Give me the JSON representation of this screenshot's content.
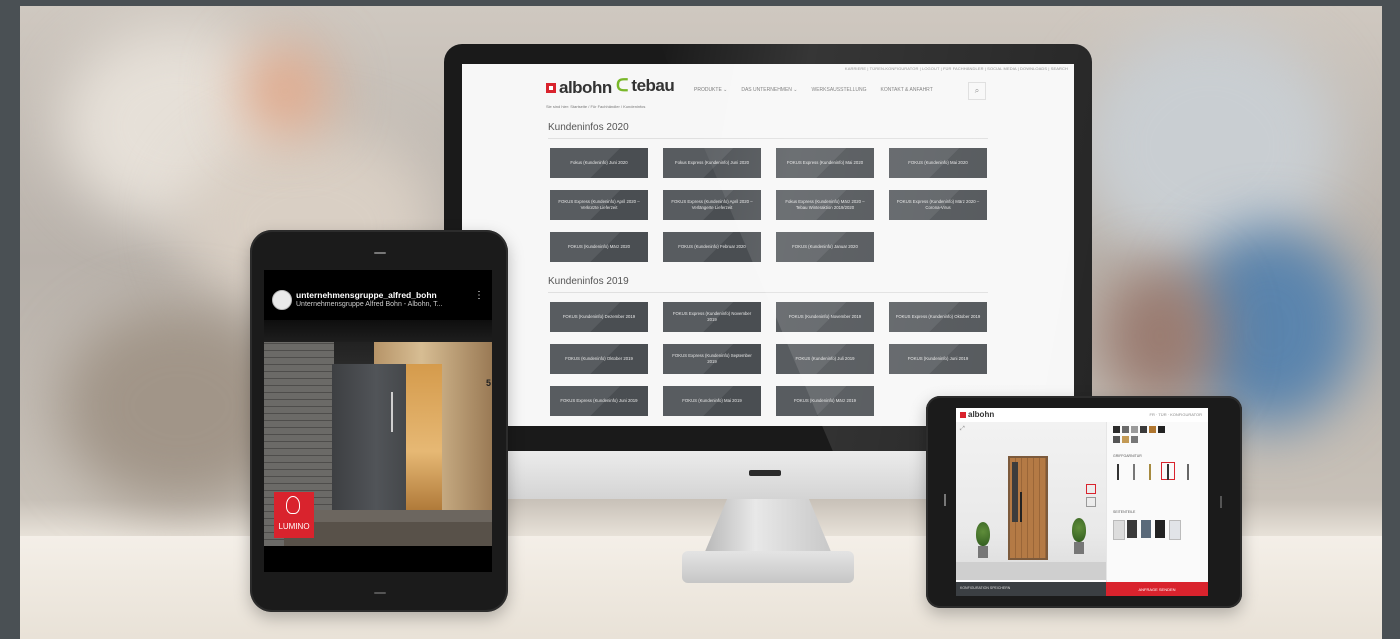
{
  "scene": {
    "colors": {
      "frame": "#4a5054",
      "brand_red": "#d9232d",
      "brand_green": "#79b729",
      "tile": "#585c60"
    }
  },
  "website": {
    "utility_links": [
      "KARRIERE",
      "TÜREN-KONFIGURATOR",
      "LOGOUT",
      "FÜR FACHHÄNDLER",
      "SOCIAL MEDIA",
      "DOWNLOADS",
      "SEARCH"
    ],
    "logo_albohn": "albohn",
    "logo_tebau": "tebau",
    "nav": [
      "PRODUKTE ⌄",
      "DAS UNTERNEHMEN ⌄",
      "WERKSAUSSTELLUNG",
      "KONTAKT & ANFAHRT"
    ],
    "breadcrumbs": "Sie sind hier:  Startseite  /  Für Fachhändler  /  Kundeninfos",
    "sections": [
      {
        "title": "Kundeninfos 2020",
        "tiles": [
          "Fokus (Kundeninfo) Juni 2020",
          "Fokus Express (Kundeninfo) Juni 2020",
          "FOKUS Express (Kundeninfo) Mai 2020",
          "FOKUS (Kundeninfo) Mai 2020",
          "FOKUS Express (Kundeninfo) April 2020 – Verkürzte Lieferzeit",
          "FOKUS Express (Kundeninfo) April 2020 – Verlängerte Lieferzeit",
          "Fokus Express (Kundeninfo) März 2020 – Tebau Winteraktion 2019/2020",
          "FOKUS Express (Kundeninfo) März 2020 – Corona-Virus",
          "FOKUS (Kundeninfo) März 2020",
          "FOKUS (Kundeninfo) Februar 2020",
          "FOKUS (Kundeninfo) Januar 2020"
        ]
      },
      {
        "title": "Kundeninfos 2019",
        "tiles": [
          "FOKUS (Kundeninfo) Dezember 2019",
          "FOKUS Express (Kundeninfo) November 2019",
          "FOKUS (Kundeninfo) November 2019",
          "FOKUS Express (Kundeninfo) Oktober 2019",
          "FOKUS (Kundeninfo) Oktober 2019",
          "FOKUS Express (Kundeninfo) September 2019",
          "FOKUS (Kundeninfo) Juli 2019",
          "FOKUS (Kundeninfo) Juni 2019",
          "FOKUS Express (Kundeninfo) Juni 2019",
          "FOKUS (Kundeninfo) Mai 2019",
          "FOKUS (Kundeninfo) März 2019"
        ]
      }
    ]
  },
  "instagram": {
    "username": "unternehmensgruppe_alfred_bohn",
    "subtitle": "Unternehmensgruppe Alfred Bohn - Albohn, T...",
    "house_number": "5",
    "badge": "LUMINO"
  },
  "configurator": {
    "logo": "albohn",
    "nav": "FR  ·  TÜR  ·  KONFIGURATOR",
    "section_handles": "GRIFFGARNITUR",
    "section_sidelights": "SEITENTEILE",
    "footer": "KONFIGURATION SPEICHERN",
    "cta": "ANFRAGE SENDEN"
  }
}
